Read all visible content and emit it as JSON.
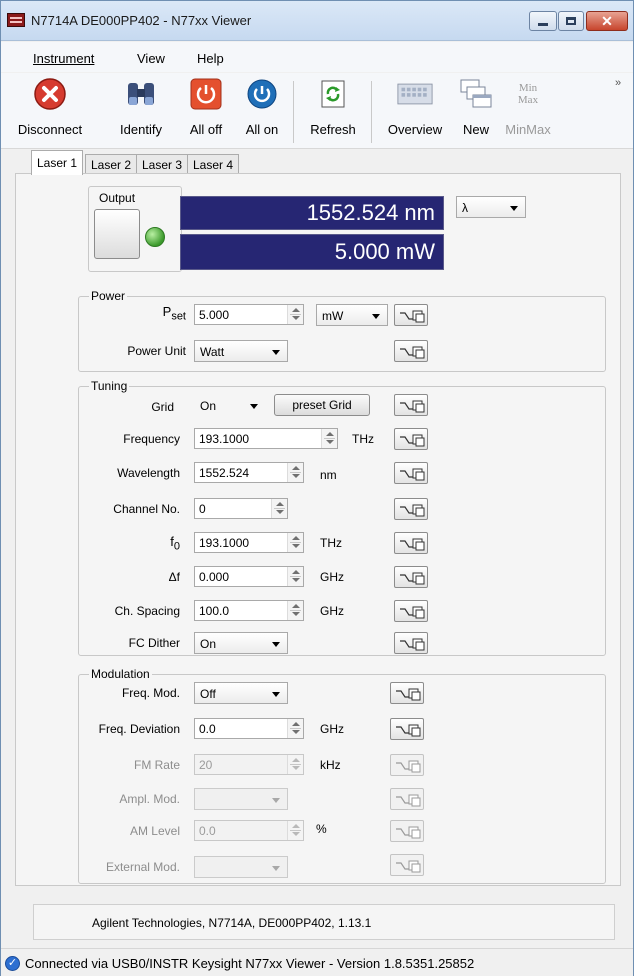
{
  "window": {
    "title": "N7714A DE000PP402 - N77xx Viewer"
  },
  "menu": [
    "Instrument",
    "View",
    "Help"
  ],
  "toolbar": {
    "disconnect": "Disconnect",
    "identify": "Identify",
    "all_off": "All off",
    "all_on": "All on",
    "refresh": "Refresh",
    "overview": "Overview",
    "new": "New",
    "minmax": "MinMax",
    "minmax_icon_top": "Min",
    "minmax_icon_bottom": "Max",
    "overflow": "»"
  },
  "tabs": [
    "Laser 1",
    "Laser 2",
    "Laser 3",
    "Laser 4"
  ],
  "output": {
    "label": "Output",
    "wavelength_display": "1552.524 nm",
    "power_display": "5.000 mW",
    "display_mode": "λ"
  },
  "power": {
    "title": "Power",
    "pset_label": "P",
    "pset_sub": "set",
    "pset_value": "5.000",
    "pset_unit": "mW",
    "unit_label": "Power Unit",
    "unit_value": "Watt"
  },
  "tuning": {
    "title": "Tuning",
    "grid_label": "Grid",
    "grid_value": "On",
    "preset_grid": "preset Grid",
    "frequency_label": "Frequency",
    "frequency_value": "193.1000",
    "frequency_unit": "THz",
    "wavelength_label": "Wavelength",
    "wavelength_value": "1552.524",
    "wavelength_unit": "nm",
    "channel_label": "Channel No.",
    "channel_value": "0",
    "f0_label": "f",
    "f0_sub": "0",
    "f0_value": "193.1000",
    "f0_unit": "THz",
    "df_label": "Δf",
    "df_value": "0.000",
    "df_unit": "GHz",
    "spacing_label": "Ch. Spacing",
    "spacing_value": "100.0",
    "spacing_unit": "GHz",
    "dither_label": "FC Dither",
    "dither_value": "On"
  },
  "modulation": {
    "title": "Modulation",
    "freq_mod_label": "Freq. Mod.",
    "freq_mod_value": "Off",
    "freq_dev_label": "Freq. Deviation",
    "freq_dev_value": "0.0",
    "freq_dev_unit": "GHz",
    "fm_rate_label": "FM Rate",
    "fm_rate_value": "20",
    "fm_rate_unit": "kHz",
    "ampl_mod_label": "Ampl. Mod.",
    "am_level_label": "AM Level",
    "am_level_value": "0.0",
    "am_level_unit": "%",
    "ext_mod_label": "External Mod."
  },
  "info": "Agilent Technologies, N7714A, DE000PP402, 1.13.1",
  "status": "Connected via USB0/INSTR  Keysight N77xx Viewer - Version 1.8.5351.25852"
}
